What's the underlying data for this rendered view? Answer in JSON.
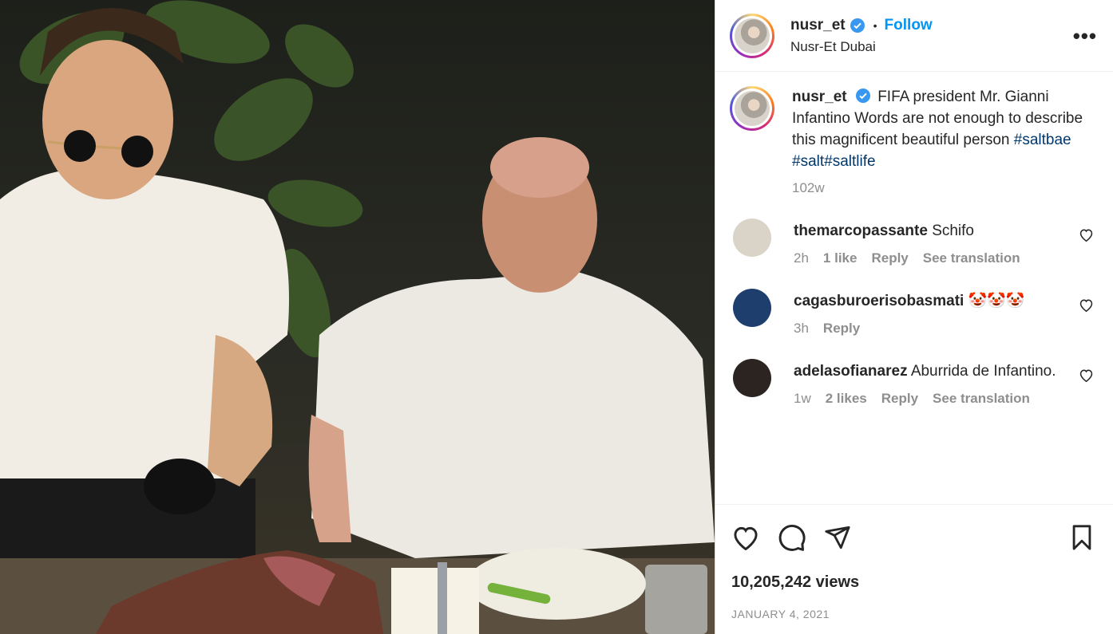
{
  "post": {
    "username": "nusr_et",
    "follow_label": "Follow",
    "dot": "•",
    "location": "Nusr-Et Dubai",
    "more_label": "•••"
  },
  "caption": {
    "username": "nusr_et",
    "text": "FIFA president Mr. Gianni Infantino Words are not enough to describe this magnificent beautiful person",
    "hashtags": [
      "#saltbae",
      "#salt#saltlife"
    ],
    "time": "102w"
  },
  "comments": [
    {
      "username": "themarcopassante",
      "text": "Schifo",
      "time": "2h",
      "likes": "1 like",
      "reply": "Reply",
      "translate": "See translation",
      "avatar_color": "#d9d3c8"
    },
    {
      "username": "cagasburoerisobasmati",
      "text": "🤡🤡🤡",
      "time": "3h",
      "likes": "",
      "reply": "Reply",
      "translate": "",
      "avatar_color": "#1e3f6e"
    },
    {
      "username": "adelasofianarez",
      "text": "Aburrida de Infantino.",
      "time": "1w",
      "likes": "2 likes",
      "reply": "Reply",
      "translate": "See translation",
      "avatar_color": "#2b2420"
    }
  ],
  "stats": {
    "views": "10,205,242 views",
    "date": "JANUARY 4, 2021"
  },
  "icons": {
    "like": "heart-icon",
    "comment": "comment-icon",
    "share": "share-icon",
    "save": "bookmark-icon",
    "verified": "verified-badge-icon"
  },
  "colors": {
    "accent": "#0095f6",
    "verified": "#3897f0",
    "hashtag": "#00376b",
    "muted": "#8e8e8e"
  }
}
